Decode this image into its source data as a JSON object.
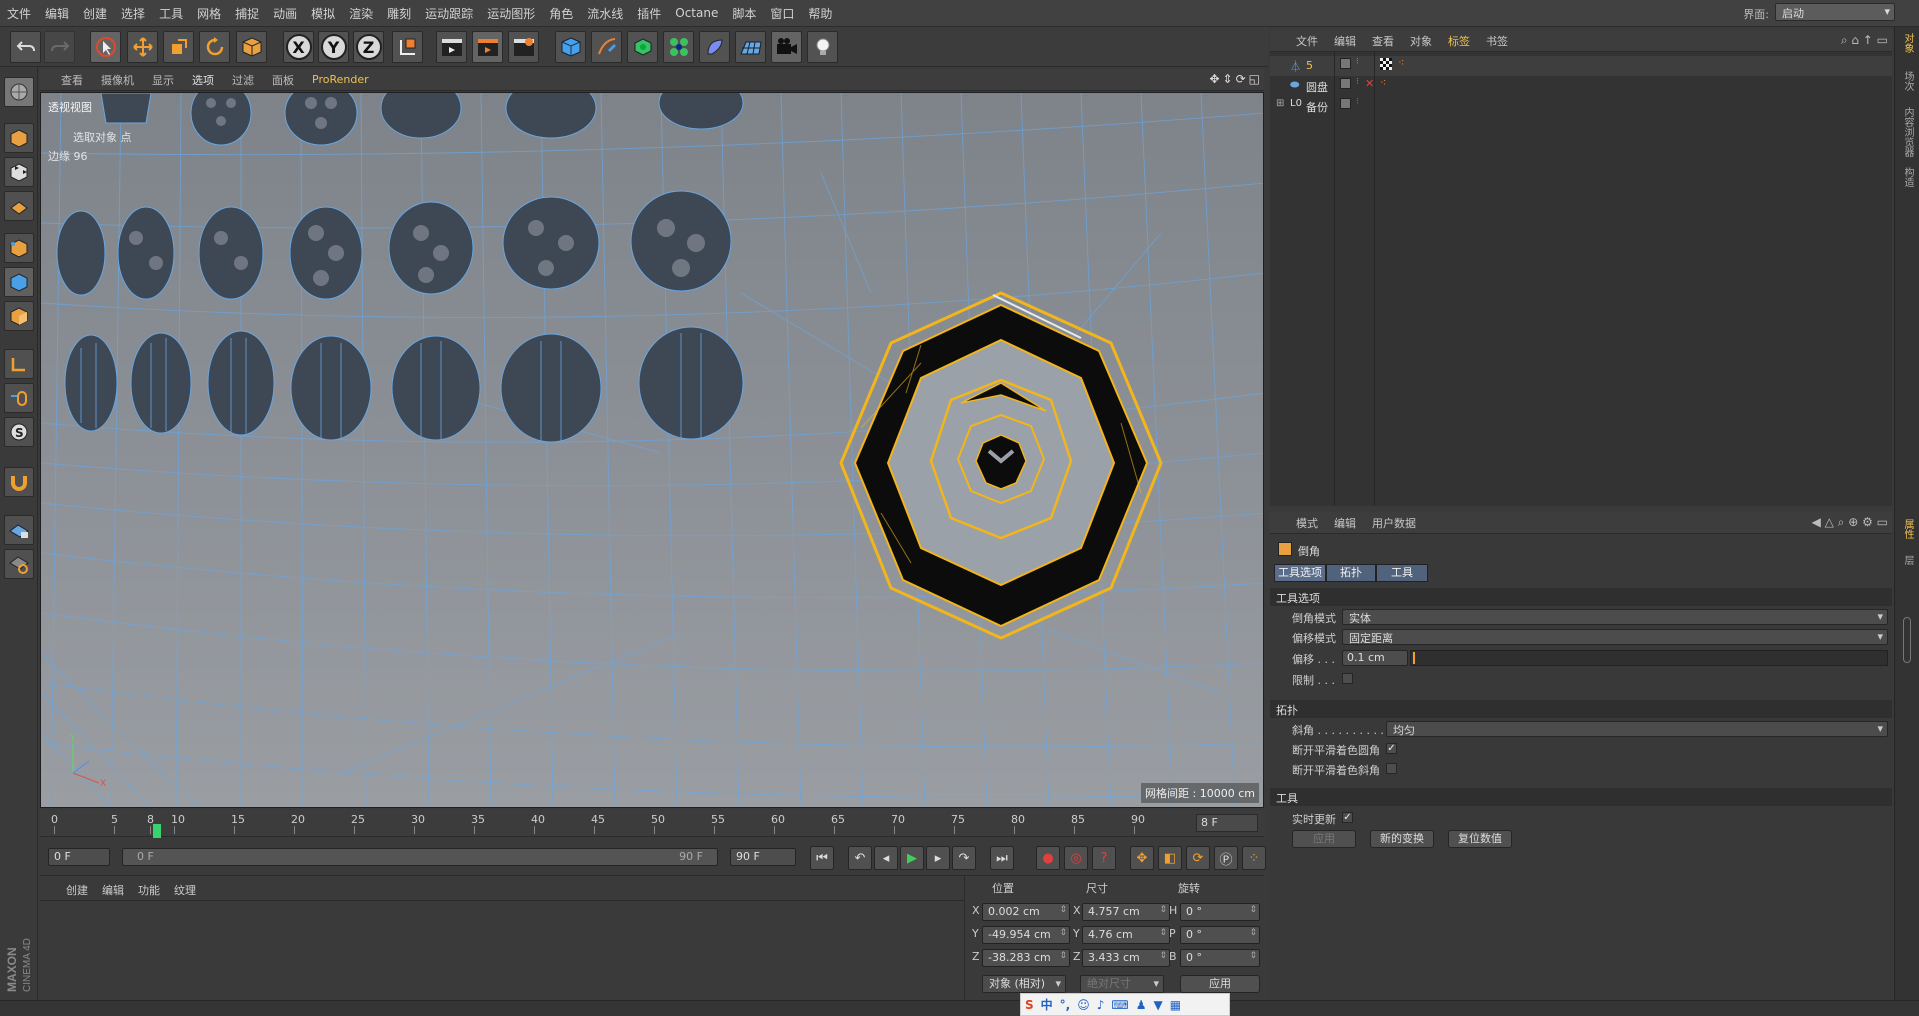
{
  "menubar": {
    "items": [
      "文件",
      "编辑",
      "创建",
      "选择",
      "工具",
      "网格",
      "捕捉",
      "动画",
      "模拟",
      "渲染",
      "雕刻",
      "运动跟踪",
      "运动图形",
      "角色",
      "流水线",
      "插件",
      "Octane",
      "脚本",
      "窗口",
      "帮助"
    ],
    "layout_label": "界面:",
    "layout_value": "启动"
  },
  "toolbar": {
    "axis_x": "X",
    "axis_y": "Y",
    "axis_z": "Z"
  },
  "viewport": {
    "menu": [
      "查看",
      "摄像机",
      "显示",
      "选项",
      "过滤",
      "面板",
      "ProRender"
    ],
    "title": "透视视图",
    "hud_selected": "选取对象  点",
    "hud_edges": "边缘  96",
    "grid_spacing": "网格间距 : 10000 cm"
  },
  "timeline": {
    "ticks": [
      "0",
      "5",
      "8",
      "10",
      "15",
      "20",
      "25",
      "30",
      "35",
      "40",
      "45",
      "50",
      "55",
      "60",
      "65",
      "70",
      "75",
      "80",
      "85",
      "90"
    ],
    "current_frame": "8 F"
  },
  "transport": {
    "start": "0 F",
    "range_start": "0 F",
    "range_end": "90 F",
    "end": "90 F"
  },
  "material_manager": {
    "menu": [
      "创建",
      "编辑",
      "功能",
      "纹理"
    ]
  },
  "coordinates": {
    "headers": [
      "位置",
      "尺寸",
      "旋转"
    ],
    "position": {
      "x": "0.002 cm",
      "y": "-49.954 cm",
      "z": "-38.283 cm"
    },
    "size": {
      "x": "4.757 cm",
      "y": "4.76 cm",
      "z": "3.433 cm"
    },
    "rotation": {
      "h": "0 °",
      "p": "0 °",
      "b": "0 °"
    },
    "axis_labels": [
      "X",
      "Y",
      "Z"
    ],
    "rot_labels": [
      "H",
      "P",
      "B"
    ],
    "mode": "对象 (相对)",
    "size_mode": "绝对尺寸",
    "apply": "应用"
  },
  "object_manager": {
    "menu": [
      "文件",
      "编辑",
      "查看",
      "对象",
      "标签",
      "书签"
    ],
    "objects": [
      {
        "name": "5"
      },
      {
        "name": "圆盘"
      },
      {
        "name": "备份"
      }
    ]
  },
  "attribute_manager": {
    "menu": [
      "模式",
      "编辑",
      "用户数据"
    ],
    "tool_name": "倒角",
    "tabs": [
      "工具选项",
      "拓扑",
      "工具"
    ],
    "section_tool_options": "工具选项",
    "bevel_mode_label": "倒角模式",
    "bevel_mode_value": "实体",
    "offset_mode_label": "偏移模式",
    "offset_mode_value": "固定距离",
    "offset_label": "偏移 . . .",
    "offset_value": "0.1 cm",
    "limit_label": "限制 . . .",
    "section_topology": "拓扑",
    "miter_label": "斜角 . . . . . . . . . .",
    "miter_value": "均匀",
    "break_rounding_label": "断开平滑着色圆角",
    "break_mitering_label": "断开平滑着色斜角",
    "section_tool": "工具",
    "realtime_label": "实时更新",
    "btn_apply": "应用",
    "btn_new_transform": "新的变换",
    "btn_reset": "复位数值"
  },
  "right_strip": {
    "tabs": [
      "对象",
      "场次",
      "内容浏览器",
      "构造",
      "属性",
      "层"
    ]
  },
  "branding": {
    "maxon": "MAXON",
    "cinema": "CINEMA 4D"
  },
  "colors": {
    "selection": "#f2b51a",
    "wire": "#6aa6e0",
    "accent": "#f0c050"
  }
}
